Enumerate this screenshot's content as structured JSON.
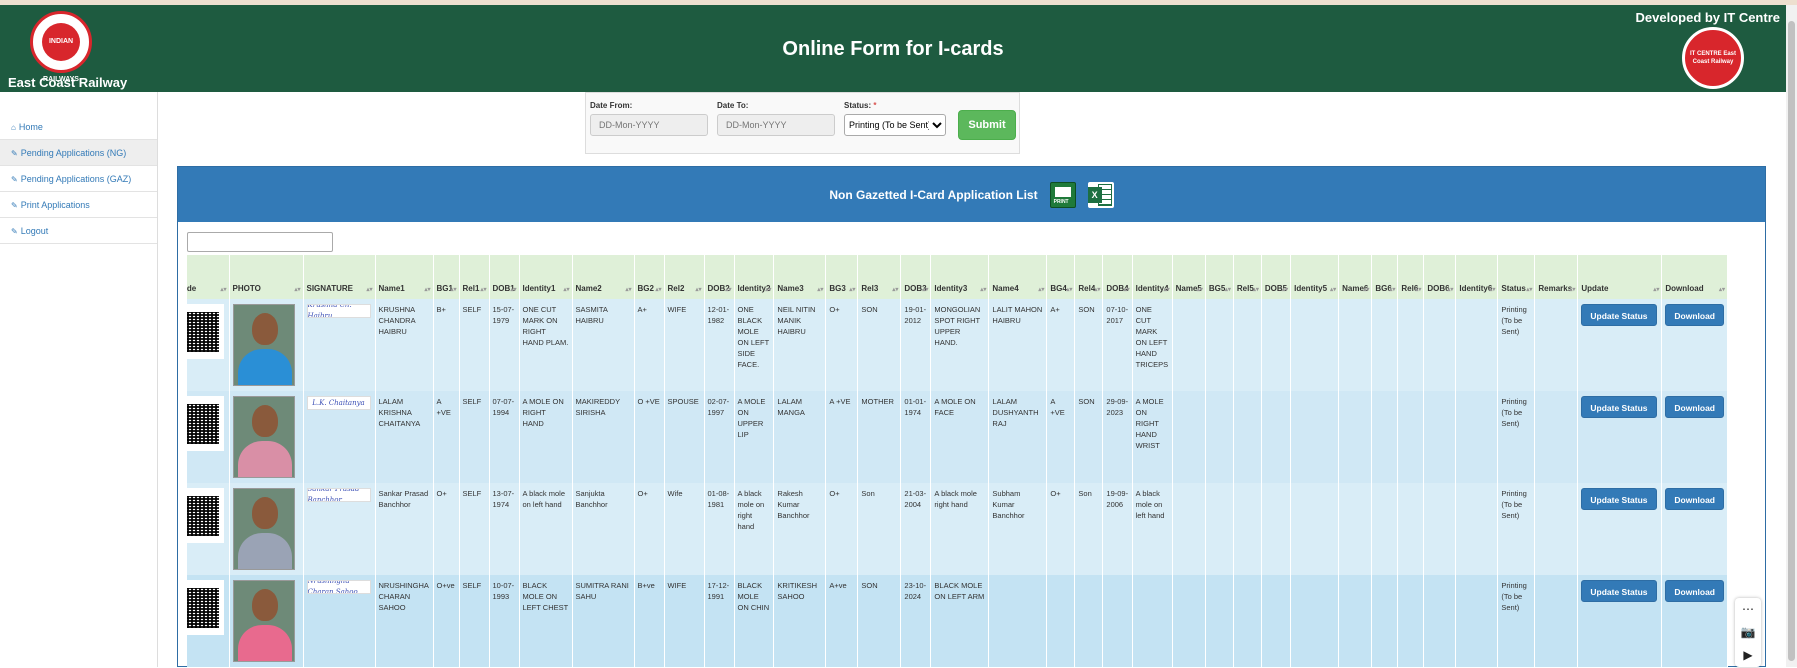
{
  "header": {
    "org_name": "East Coast Railway",
    "title": "Online Form for I-cards",
    "developed_by": "Developed by IT Centre",
    "logo_left_text": "INDIAN RAILWAYS",
    "logo_right_text": "IT CENTRE East Coast Railway"
  },
  "sidebar": {
    "items": [
      {
        "icon": "home-icon",
        "label": "Home"
      },
      {
        "icon": "edit-icon",
        "label": "Pending Applications (NG)"
      },
      {
        "icon": "edit-icon",
        "label": "Pending Applications (GAZ)"
      },
      {
        "icon": "edit-icon",
        "label": "Print Applications"
      },
      {
        "icon": "edit-icon",
        "label": "Logout"
      }
    ]
  },
  "filter": {
    "date_from_label": "Date From:",
    "date_from_placeholder": "DD-Mon-YYYY",
    "date_to_label": "Date To:",
    "date_to_placeholder": "DD-Mon-YYYY",
    "status_label": "Status:",
    "status_required": "*",
    "status_value": "Printing (To be Sent)",
    "submit_label": "Submit"
  },
  "panel": {
    "title": "Non Gazetted I-Card Application List",
    "print_label": "PRINT",
    "excel_label": "X"
  },
  "table": {
    "columns": [
      "ode",
      "PHOTO",
      "SIGNATURE",
      "Name1",
      "BG1",
      "Rel1",
      "DOB1",
      "Identity1",
      "Name2",
      "BG2",
      "Rel2",
      "DOB2",
      "Identity2",
      "Name3",
      "BG3",
      "Rel3",
      "DOB3",
      "Identity3",
      "Name4",
      "BG4",
      "Rel4",
      "DOB4",
      "Identity4",
      "Name5",
      "BG5",
      "Rel5",
      "DOB5",
      "Identity5",
      "Name6",
      "BG6",
      "Rel6",
      "DOB6",
      "Identity6",
      "Status",
      "Remarks",
      "Update",
      "Download"
    ],
    "rows": [
      {
        "signature": "Krushna Ch. Haibru",
        "shirt_color": "#2a8fd6",
        "cells": [
          "KRUSHNA CHANDRA HAIBRU",
          "B+",
          "SELF",
          "15-07-1979",
          "ONE CUT MARK ON RIGHT HAND PLAM.",
          "SASMITA HAIBRU",
          "A+",
          "WIFE",
          "12-01-1982",
          "ONE BLACK MOLE ON LEFT SIDE FACE.",
          "NEIL NITIN MANIK HAIBRU",
          "O+",
          "SON",
          "19-01-2012",
          "MONGOLIAN SPOT RIGHT UPPER HAND.",
          "LALIT MAHON HAIBRU",
          "A+",
          "SON",
          "07-10-2017",
          "ONE CUT MARK ON LEFT HAND TRICEPS",
          "",
          "",
          "",
          "",
          "",
          "",
          "",
          "",
          "",
          "",
          "Printing (To be Sent)",
          ""
        ]
      },
      {
        "signature": "L.K. Chaitanya",
        "shirt_color": "#d98fa6",
        "cells": [
          "LALAM KRISHNA CHAITANYA",
          "A +VE",
          "SELF",
          "07-07-1994",
          "A MOLE ON RIGHT HAND",
          "MAKIREDDY SIRISHA",
          "O +VE",
          "SPOUSE",
          "02-07-1997",
          "A MOLE ON UPPER LIP",
          "LALAM MANGA",
          "A +VE",
          "MOTHER",
          "01-01-1974",
          "A MOLE ON FACE",
          "LALAM DUSHYANTH RAJ",
          "A +VE",
          "SON",
          "29-09-2023",
          "A MOLE ON RIGHT HAND WRIST",
          "",
          "",
          "",
          "",
          "",
          "",
          "",
          "",
          "",
          "",
          "Printing (To be Sent)",
          ""
        ]
      },
      {
        "signature": "Sankar Prasad Banchhor",
        "shirt_color": "#9aa3b5",
        "cells": [
          "Sankar Prasad Banchhor",
          "O+",
          "SELF",
          "13-07-1974",
          "A black mole on left hand",
          "Sanjukta Banchhor",
          "O+",
          "Wife",
          "01-08-1981",
          "A black mole on right hand",
          "Rakesh Kumar Banchhor",
          "O+",
          "Son",
          "21-03-2004",
          "A black mole right hand",
          "Subham Kumar Banchhor",
          "O+",
          "Son",
          "19-09-2006",
          "A black mole on left hand",
          "",
          "",
          "",
          "",
          "",
          "",
          "",
          "",
          "",
          "",
          "Printing (To be Sent)",
          ""
        ]
      },
      {
        "signature": "Nrushingha Charan Sahoo",
        "shirt_color": "#e86a8e",
        "cells": [
          "NRUSHINGHA CHARAN SAHOO",
          "O+ve",
          "SELF",
          "10-07-1993",
          "BLACK MOLE ON LEFT CHEST",
          "SUMITRA RANI SAHU",
          "B+ve",
          "WIFE",
          "17-12-1991",
          "BLACK MOLE ON CHIN",
          "KRITIKESH SAHOO",
          "A+ve",
          "SON",
          "23-10-2024",
          "BLACK MOLE ON LEFT ARM",
          "",
          "",
          "",
          "",
          "",
          "",
          "",
          "",
          "",
          "",
          "",
          "",
          "",
          "",
          "",
          "Printing (To be Sent)",
          ""
        ]
      }
    ],
    "update_label": "Update Status",
    "download_label": "Download"
  },
  "float_tools": [
    "camera-icon",
    "video-icon"
  ]
}
